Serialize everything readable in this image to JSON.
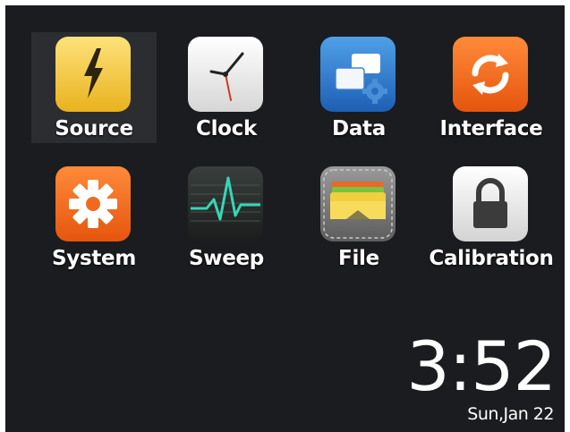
{
  "apps": [
    {
      "label": "Source",
      "icon": "lightning-icon",
      "selected": true
    },
    {
      "label": "Clock",
      "icon": "clock-icon",
      "selected": false
    },
    {
      "label": "Data",
      "icon": "data-windows-gear-icon",
      "selected": false
    },
    {
      "label": "Interface",
      "icon": "refresh-arrows-icon",
      "selected": false
    },
    {
      "label": "System",
      "icon": "gear-icon",
      "selected": false
    },
    {
      "label": "Sweep",
      "icon": "waveform-icon",
      "selected": false
    },
    {
      "label": "File",
      "icon": "folder-icon",
      "selected": false
    },
    {
      "label": "Calibration",
      "icon": "lock-icon",
      "selected": false
    }
  ],
  "status": {
    "time": "3:52",
    "date": "Sun,Jan 22"
  },
  "colors": {
    "background": "#1b1c1f",
    "selection": "#2c2d31",
    "source_yellow": "#f2c531",
    "accent_orange": "#f26a1d",
    "data_blue": "#2b6fc2",
    "sweep_green": "#35d4b4"
  }
}
